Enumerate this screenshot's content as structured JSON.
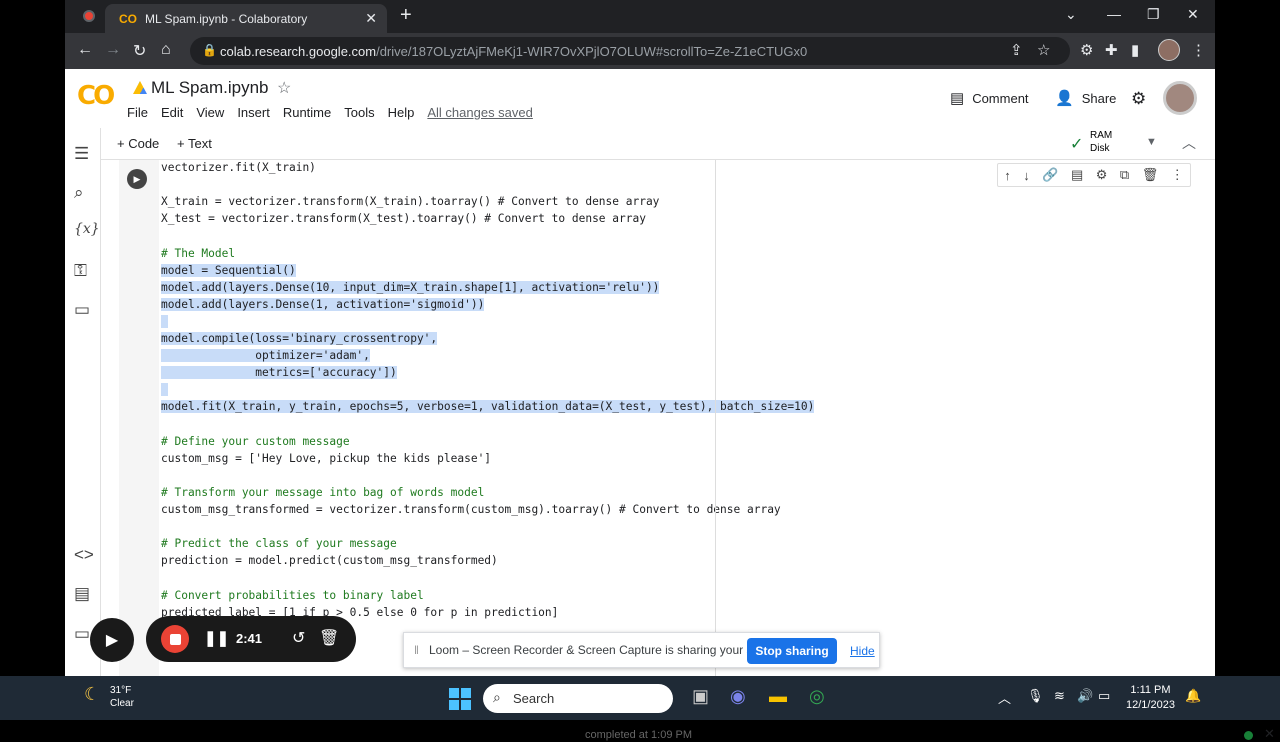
{
  "browser": {
    "tab_title": "ML Spam.ipynb - Colaboratory",
    "tab_icon": "CO",
    "url_host": "colab.research.google.com",
    "url_path": "/drive/187OLyztAjFMeKj1-WIR7OvXPjlO7OLUW#scrollTo=Ze-Z1eCTUGx0"
  },
  "colab": {
    "logo": "CO",
    "notebook_title": "ML Spam.ipynb",
    "menu": [
      "File",
      "Edit",
      "View",
      "Insert",
      "Runtime",
      "Tools",
      "Help"
    ],
    "saved_status": "All changes saved",
    "comment_label": "Comment",
    "share_label": "Share",
    "add_code": "+ Code",
    "add_text": "+ Text",
    "ram_label": "RAM",
    "disk_label": "Disk"
  },
  "code_lines": [
    {
      "text": "vectorizer.fit(X_train)",
      "hl": false
    },
    {
      "text": "",
      "hl": false
    },
    {
      "text": "X_train = vectorizer.transform(X_train).toarray() # Convert to dense array",
      "hl": false
    },
    {
      "text": "X_test = vectorizer.transform(X_test).toarray() # Convert to dense array",
      "hl": false
    },
    {
      "text": "",
      "hl": false
    },
    {
      "text": "# The Model",
      "hl": false
    },
    {
      "text": "model = Sequential()",
      "hl": true
    },
    {
      "text": "model.add(layers.Dense(10, input_dim=X_train.shape[1], activation='relu'))",
      "hl": true
    },
    {
      "text": "model.add(layers.Dense(1, activation='sigmoid'))",
      "hl": true
    },
    {
      "text": "",
      "hl": true
    },
    {
      "text": "model.compile(loss='binary_crossentropy',",
      "hl": true
    },
    {
      "text": "              optimizer='adam',",
      "hl": true
    },
    {
      "text": "              metrics=['accuracy'])",
      "hl": true
    },
    {
      "text": "",
      "hl": true
    },
    {
      "text": "model.fit(X_train, y_train, epochs=5, verbose=1, validation_data=(X_test, y_test), batch_size=10)",
      "hl": true
    },
    {
      "text": "",
      "hl": false
    },
    {
      "text": "# Define your custom message",
      "hl": false
    },
    {
      "text": "custom_msg = ['Hey Love, pickup the kids please']",
      "hl": false
    },
    {
      "text": "",
      "hl": false
    },
    {
      "text": "# Transform your message into bag of words model",
      "hl": false
    },
    {
      "text": "custom_msg_transformed = vectorizer.transform(custom_msg).toarray() # Convert to dense array",
      "hl": false
    },
    {
      "text": "",
      "hl": false
    },
    {
      "text": "# Predict the class of your message",
      "hl": false
    },
    {
      "text": "prediction = model.predict(custom_msg_transformed)",
      "hl": false
    },
    {
      "text": "",
      "hl": false
    },
    {
      "text": "# Convert probabilities to binary label",
      "hl": false
    },
    {
      "text": "predicted_label = [1 if p > 0.5 else 0 for p in prediction]",
      "hl": false
    }
  ],
  "recorder": {
    "timer": "2:41",
    "loom_message": "Loom – Screen Recorder & Screen Capture is sharing your screen.",
    "stop_sharing": "Stop sharing",
    "hide": "Hide",
    "status_line": "completed at 1:09 PM"
  },
  "taskbar": {
    "temperature": "31°F",
    "weather": "Clear",
    "search_placeholder": "Search",
    "time": "1:11 PM",
    "date": "12/1/2023"
  },
  "colors": {
    "accent_orange": "#f9ab00",
    "selection": "#c8dcf8",
    "loom_blue": "#1a73e8"
  }
}
